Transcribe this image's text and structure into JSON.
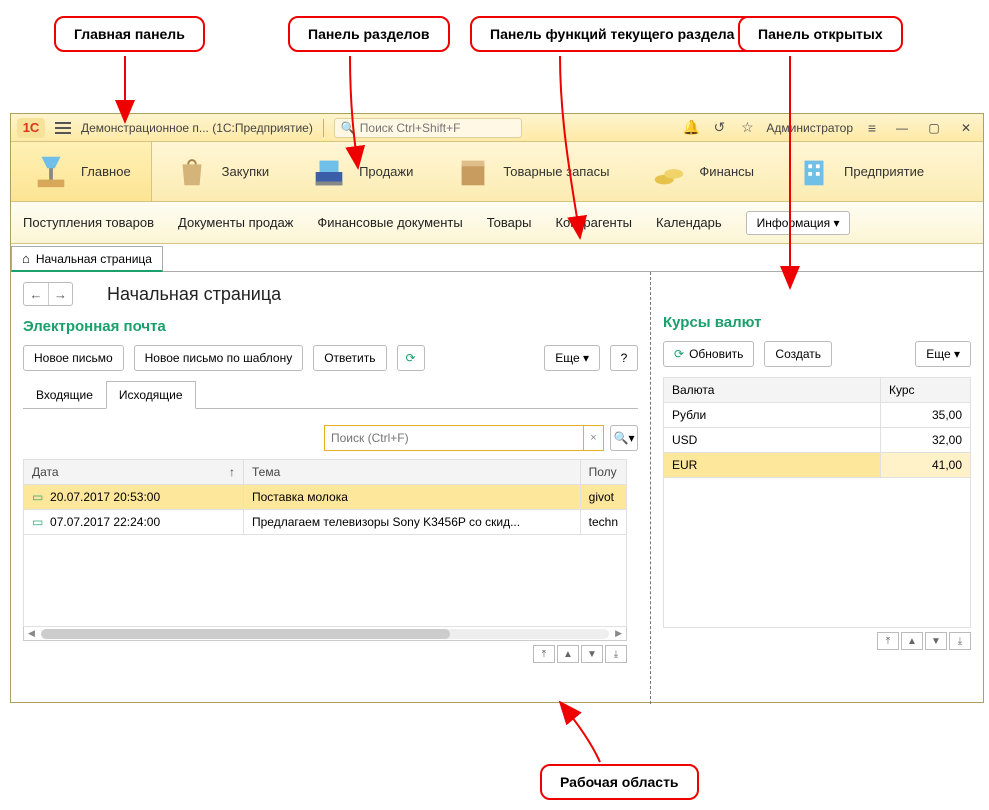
{
  "callouts": {
    "main_panel": "Главная панель",
    "sections_panel": "Панель разделов",
    "functions_panel": "Панель функций текущего раздела",
    "open_panel": "Панель открытых",
    "work_area": "Рабочая область"
  },
  "titlebar": {
    "logo": "1C",
    "app_title": "Демонстрационное п...  (1С:Предприятие)",
    "search_placeholder": "Поиск Ctrl+Shift+F",
    "user": "Администратор"
  },
  "sections": {
    "main": "Главное",
    "purchasing": "Закупки",
    "sales": "Продажи",
    "stock": "Товарные запасы",
    "finance": "Финансы",
    "enterprise": "Предприятие"
  },
  "functions": {
    "f0": "Поступления товаров",
    "f1": "Документы продаж",
    "f2": "Финансовые документы",
    "f3": "Товары",
    "f4": "Контрагенты",
    "f5": "Календарь",
    "info_btn": "Информация ▾"
  },
  "open_tabs": {
    "home": "Начальная страница"
  },
  "page": {
    "title": "Начальная страница",
    "email": {
      "title": "Электронная почта",
      "new_msg": "Новое письмо",
      "new_tpl": "Новое письмо по шаблону",
      "reply": "Ответить",
      "more": "Еще ▾",
      "help": "?",
      "tab_in": "Входящие",
      "tab_out": "Исходящие",
      "search_ph": "Поиск (Ctrl+F)",
      "col_date": "Дата",
      "col_subj": "Тема",
      "col_to": "Полу",
      "rows": [
        {
          "date": "20.07.2017 20:53:00",
          "subj": "Поставка молока",
          "to": "givot"
        },
        {
          "date": "07.07.2017 22:24:00",
          "subj": "Предлагаем телевизоры Sony K3456P со скид...",
          "to": "techn"
        }
      ]
    },
    "rates": {
      "title": "Курсы валют",
      "refresh": "Обновить",
      "create": "Создать",
      "more": "Еще ▾",
      "col_cur": "Валюта",
      "col_rate": "Курс",
      "rows": [
        {
          "cur": "Рубли",
          "rate": "35,00"
        },
        {
          "cur": "USD",
          "rate": "32,00"
        },
        {
          "cur": "EUR",
          "rate": "41,00"
        }
      ]
    }
  }
}
